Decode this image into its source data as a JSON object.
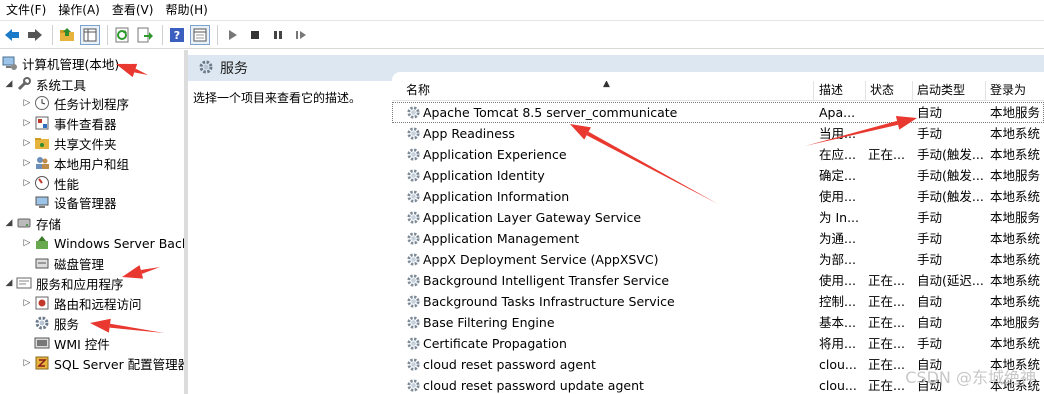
{
  "menubar": {
    "items": [
      "文件(F)",
      "操作(A)",
      "查看(V)",
      "帮助(H)"
    ]
  },
  "toolbar": {
    "icons": [
      "back-icon",
      "forward-icon",
      "up-folder-icon",
      "show-hide-tree-icon",
      "refresh-icon",
      "export-list-icon",
      "help-icon",
      "properties-icon",
      "play-icon",
      "stop-icon",
      "pause-icon",
      "resume-icon"
    ]
  },
  "tree": {
    "root": "计算机管理(本地)",
    "system_tools": "系统工具",
    "task_scheduler": "任务计划程序",
    "event_viewer": "事件查看器",
    "shared_folders": "共享文件夹",
    "local_users": "本地用户和组",
    "performance": "性能",
    "device_manager": "设备管理器",
    "storage": "存储",
    "windows_server_backup": "Windows Server Back",
    "disk_management": "磁盘管理",
    "services_apps": "服务和应用程序",
    "routing": "路由和远程访问",
    "services": "服务",
    "wmi": "WMI 控件",
    "sql_server": "SQL Server 配置管理器"
  },
  "main": {
    "title": "服务",
    "description_hint": "选择一个项目来查看它的描述。",
    "columns": {
      "name": "名称",
      "description": "描述",
      "status": "状态",
      "startup_type": "启动类型",
      "log_on_as": "登录为"
    },
    "services": [
      {
        "name": "Apache Tomcat 8.5 server_communicate",
        "desc": "Apa...",
        "status": "",
        "startup": "自动",
        "logon": "本地服务"
      },
      {
        "name": "App Readiness",
        "desc": "当用...",
        "status": "",
        "startup": "手动",
        "logon": "本地系统"
      },
      {
        "name": "Application Experience",
        "desc": "在应...",
        "status": "正在...",
        "startup": "手动(触发...",
        "logon": "本地系统"
      },
      {
        "name": "Application Identity",
        "desc": "确定...",
        "status": "",
        "startup": "手动(触发...",
        "logon": "本地服务"
      },
      {
        "name": "Application Information",
        "desc": "使用...",
        "status": "",
        "startup": "手动(触发...",
        "logon": "本地系统"
      },
      {
        "name": "Application Layer Gateway Service",
        "desc": "为 In...",
        "status": "",
        "startup": "手动",
        "logon": "本地服务"
      },
      {
        "name": "Application Management",
        "desc": "为通...",
        "status": "",
        "startup": "手动",
        "logon": "本地系统"
      },
      {
        "name": "AppX Deployment Service (AppXSVC)",
        "desc": "为部...",
        "status": "",
        "startup": "手动",
        "logon": "本地系统"
      },
      {
        "name": "Background Intelligent Transfer Service",
        "desc": "使用...",
        "status": "正在...",
        "startup": "自动(延迟...",
        "logon": "本地系统"
      },
      {
        "name": "Background Tasks Infrastructure Service",
        "desc": "控制...",
        "status": "正在...",
        "startup": "自动",
        "logon": "本地系统"
      },
      {
        "name": "Base Filtering Engine",
        "desc": "基本...",
        "status": "正在...",
        "startup": "自动",
        "logon": "本地服务"
      },
      {
        "name": "Certificate Propagation",
        "desc": "将用...",
        "status": "正在...",
        "startup": "手动",
        "logon": "本地系统"
      },
      {
        "name": "cloud reset password agent",
        "desc": "clou...",
        "status": "正在...",
        "startup": "自动",
        "logon": "本地系统"
      },
      {
        "name": "cloud reset password update agent",
        "desc": "clou...",
        "status": "正在...",
        "startup": "自动",
        "logon": "本地系统"
      }
    ]
  },
  "watermark": "CSDN @东城绝神",
  "colors": {
    "annotation_arrow": "#e8382f",
    "header_band": "#dde7f1",
    "folder_yellow": "#e6b43c"
  }
}
